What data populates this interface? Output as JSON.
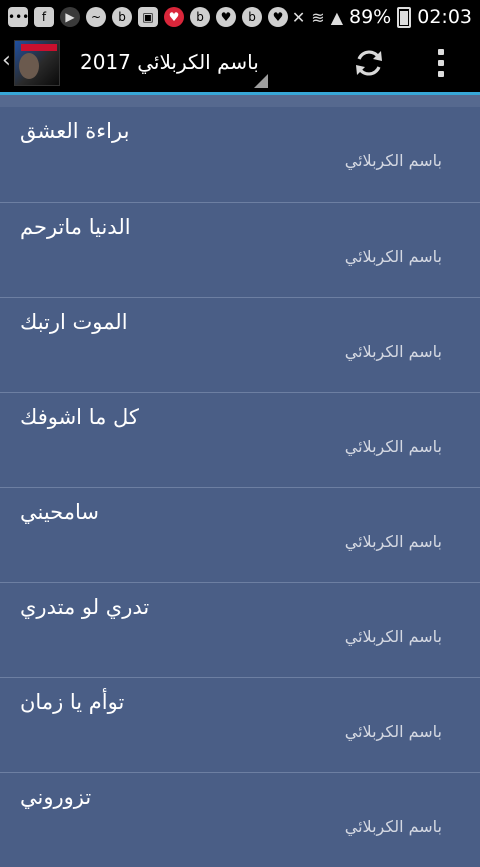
{
  "status_bar": {
    "battery": "89%",
    "time": "02:03",
    "notification_icons": [
      "chat-icon",
      "facebook-icon",
      "play-icon",
      "messenger-icon",
      "b-icon",
      "gallery-icon",
      "heart-red-icon",
      "b-icon",
      "heart-icon",
      "b-icon",
      "heart-icon"
    ]
  },
  "action_bar": {
    "title": "باسم الكربلائي 2017",
    "refresh_icon": "refresh-icon",
    "overflow_icon": "more-vert-icon"
  },
  "colors": {
    "list_background": "#4a5e86",
    "accent_line": "#37a7d8",
    "divider": "#6d7fa2"
  },
  "songs": [
    {
      "title": "براءة العشق",
      "artist": "باسم الكربلائي"
    },
    {
      "title": "الدنيا ماترحم",
      "artist": "باسم الكربلائي"
    },
    {
      "title": "الموت ارتبك",
      "artist": "باسم الكربلائي"
    },
    {
      "title": "كل ما اشوفك",
      "artist": "باسم الكربلائي"
    },
    {
      "title": "سامحيني",
      "artist": "باسم الكربلائي"
    },
    {
      "title": "تدري لو متدري",
      "artist": "باسم الكربلائي"
    },
    {
      "title": "توأم يا زمان",
      "artist": "باسم الكربلائي"
    },
    {
      "title": "تزوروني",
      "artist": "باسم الكربلائي"
    }
  ]
}
